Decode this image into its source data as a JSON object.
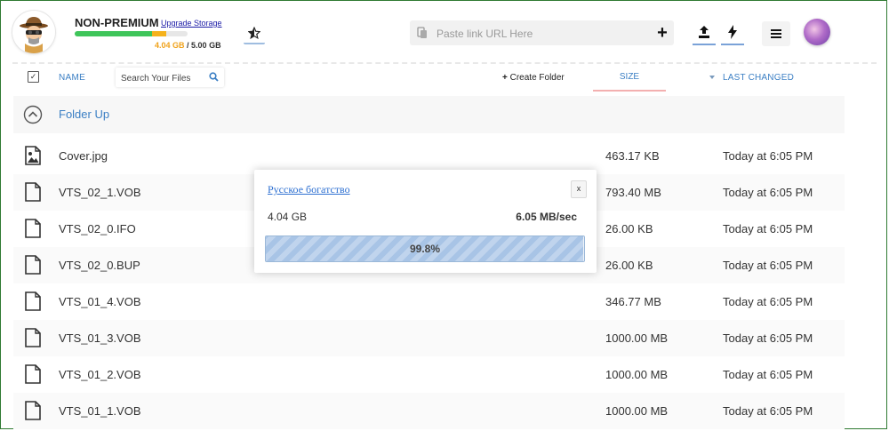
{
  "account": {
    "plan_label": "NON-PREMIUM",
    "upgrade_label": "Upgrade Storage",
    "storage_used": "4.04 GB",
    "storage_total": "/ 5.00 GB",
    "usage_fraction": 0.808
  },
  "toolbar": {
    "url_placeholder": "Paste link URL Here",
    "add_label": "+"
  },
  "columns": {
    "name": "NAME",
    "search_placeholder": "Search Your Files",
    "create_folder": "Create Folder",
    "size": "SIZE",
    "last_changed": "LAST CHANGED"
  },
  "folder_up": "Folder Up",
  "files": [
    {
      "name": "Cover.jpg",
      "size": "463.17 KB",
      "changed": "Today at 6:05 PM",
      "icon": "image-file-icon"
    },
    {
      "name": "VTS_02_1.VOB",
      "size": "793.40 MB",
      "changed": "Today at 6:05 PM",
      "icon": "file-icon"
    },
    {
      "name": "VTS_02_0.IFO",
      "size": "26.00 KB",
      "changed": "Today at 6:05 PM",
      "icon": "file-icon"
    },
    {
      "name": "VTS_02_0.BUP",
      "size": "26.00 KB",
      "changed": "Today at 6:05 PM",
      "icon": "file-icon"
    },
    {
      "name": "VTS_01_4.VOB",
      "size": "346.77 MB",
      "changed": "Today at 6:05 PM",
      "icon": "file-icon"
    },
    {
      "name": "VTS_01_3.VOB",
      "size": "1000.00 MB",
      "changed": "Today at 6:05 PM",
      "icon": "file-icon"
    },
    {
      "name": "VTS_01_2.VOB",
      "size": "1000.00 MB",
      "changed": "Today at 6:05 PM",
      "icon": "file-icon"
    },
    {
      "name": "VTS_01_1.VOB",
      "size": "1000.00 MB",
      "changed": "Today at 6:05 PM",
      "icon": "file-icon"
    }
  ],
  "upload": {
    "title": "Русское богатство",
    "close_label": "x",
    "size": "4.04 GB",
    "speed": "6.05 MB/sec",
    "progress_text": "99.8%",
    "progress": 0.998
  },
  "colors": {
    "accent": "#3b7fc4",
    "storage_used": "#3fc55a",
    "storage_warn": "#f5b21c",
    "progress_fill": "#a8c4e6"
  }
}
